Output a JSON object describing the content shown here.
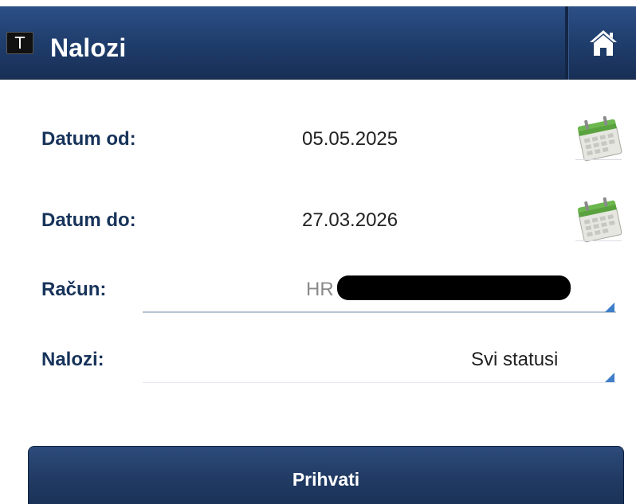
{
  "header": {
    "badge": "T",
    "title": "Nalozi",
    "home_icon": "home-icon"
  },
  "form": {
    "date_from": {
      "label": "Datum od:",
      "value": "05.05.2025",
      "icon": "calendar-icon"
    },
    "date_to": {
      "label": "Datum do:",
      "value": "27.03.2026",
      "icon": "calendar-icon"
    },
    "account": {
      "label": "Račun:",
      "value_prefix": "HR"
    },
    "orders": {
      "label": "Nalozi:",
      "value": "Svi statusi"
    }
  },
  "submit": {
    "label": "Prihvati"
  },
  "colors": {
    "header": "#1e3c6a",
    "label": "#17335a",
    "dropdown_corner": "#3f7ec9",
    "button": "#213b64"
  }
}
